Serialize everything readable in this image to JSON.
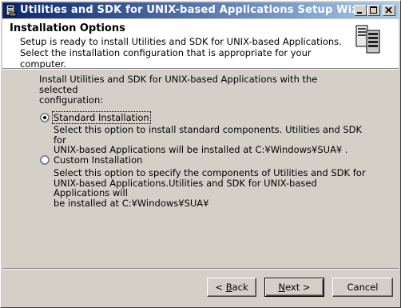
{
  "window": {
    "title": "Utilities and SDK for UNIX-based Applications Setup Wizard"
  },
  "header": {
    "title": "Installation Options",
    "description_line1": "Setup is ready to install Utilities and SDK for UNIX-based Applications.",
    "description_line2": "Select the installation configuration that is appropriate for your computer."
  },
  "body": {
    "intro_line1": "Install Utilities and SDK for UNIX-based Applications with the selected",
    "intro_line2": "configuration:"
  },
  "options": [
    {
      "label": "Standard Installation",
      "selected": true,
      "desc_line1": "Select this option to install standard components. Utilities and SDK for",
      "desc_line2": "UNIX-based Applications will be installed at C:¥Windows¥SUA¥ ."
    },
    {
      "label": "Custom Installation",
      "selected": false,
      "desc_line1": "Select this option to specify the components  of Utilities and SDK for",
      "desc_line2": "UNIX-based Applications.Utilities and SDK for UNIX-based Applications will",
      "desc_line3": "be installed at C:¥Windows¥SUA¥"
    }
  ],
  "buttons": {
    "back_prefix": "< ",
    "back_key": "B",
    "back_rest": "ack",
    "next_key": "N",
    "next_rest": "ext >",
    "cancel": "Cancel"
  },
  "icons": {
    "app": "setup-app-icon",
    "header": "server-computers-icon"
  }
}
